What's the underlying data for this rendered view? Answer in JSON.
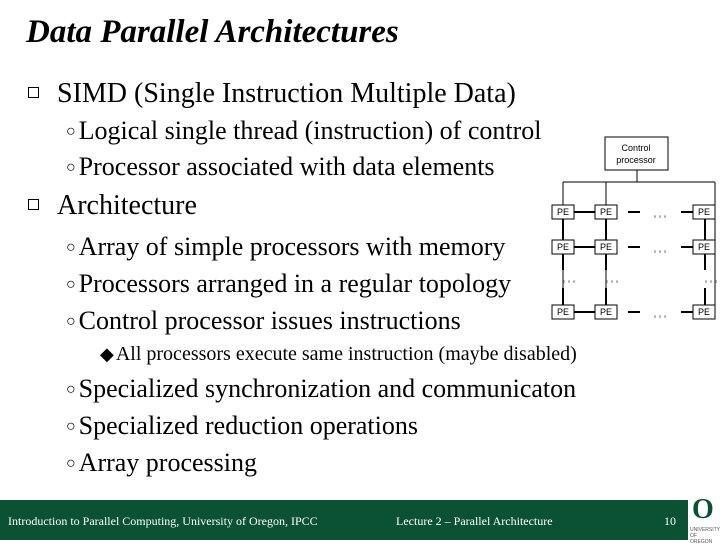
{
  "slide": {
    "title": "Data Parallel Architectures",
    "bullets": [
      {
        "text": "SIMD (Single Instruction Multiple Data)",
        "level": 1
      },
      {
        "text": "Logical single thread (instruction) of control",
        "level": 2
      },
      {
        "text": "Processor associated with data elements",
        "level": 2
      },
      {
        "text": "Architecture",
        "level": 1
      },
      {
        "text": "Array of simple processors with memory",
        "level": 2
      },
      {
        "text": "Processors arranged in a regular topology",
        "level": 2
      },
      {
        "text": "Control processor issues instructions",
        "level": 2
      },
      {
        "text": "All processors execute same instruction (maybe disabled)",
        "level": 3
      },
      {
        "text": "Specialized synchronization and communicaton",
        "level": 2
      },
      {
        "text": "Specialized reduction operations",
        "level": 2
      },
      {
        "text": "Array processing",
        "level": 2
      }
    ]
  },
  "diagram": {
    "control_label_line1": "Control",
    "control_label_line2": "processor",
    "pe_label": "PE",
    "ellipsis": "◦ ◦ ◦"
  },
  "footer": {
    "left": "Introduction to Parallel Computing, University of Oregon, IPCC",
    "center": "Lecture 2 – Parallel Architecture",
    "page": "10",
    "logo_letter": "O",
    "logo_text_1": "UNIVERSITY",
    "logo_text_2": "OF OREGON"
  },
  "colors": {
    "footer_bg": "#0b5234"
  }
}
